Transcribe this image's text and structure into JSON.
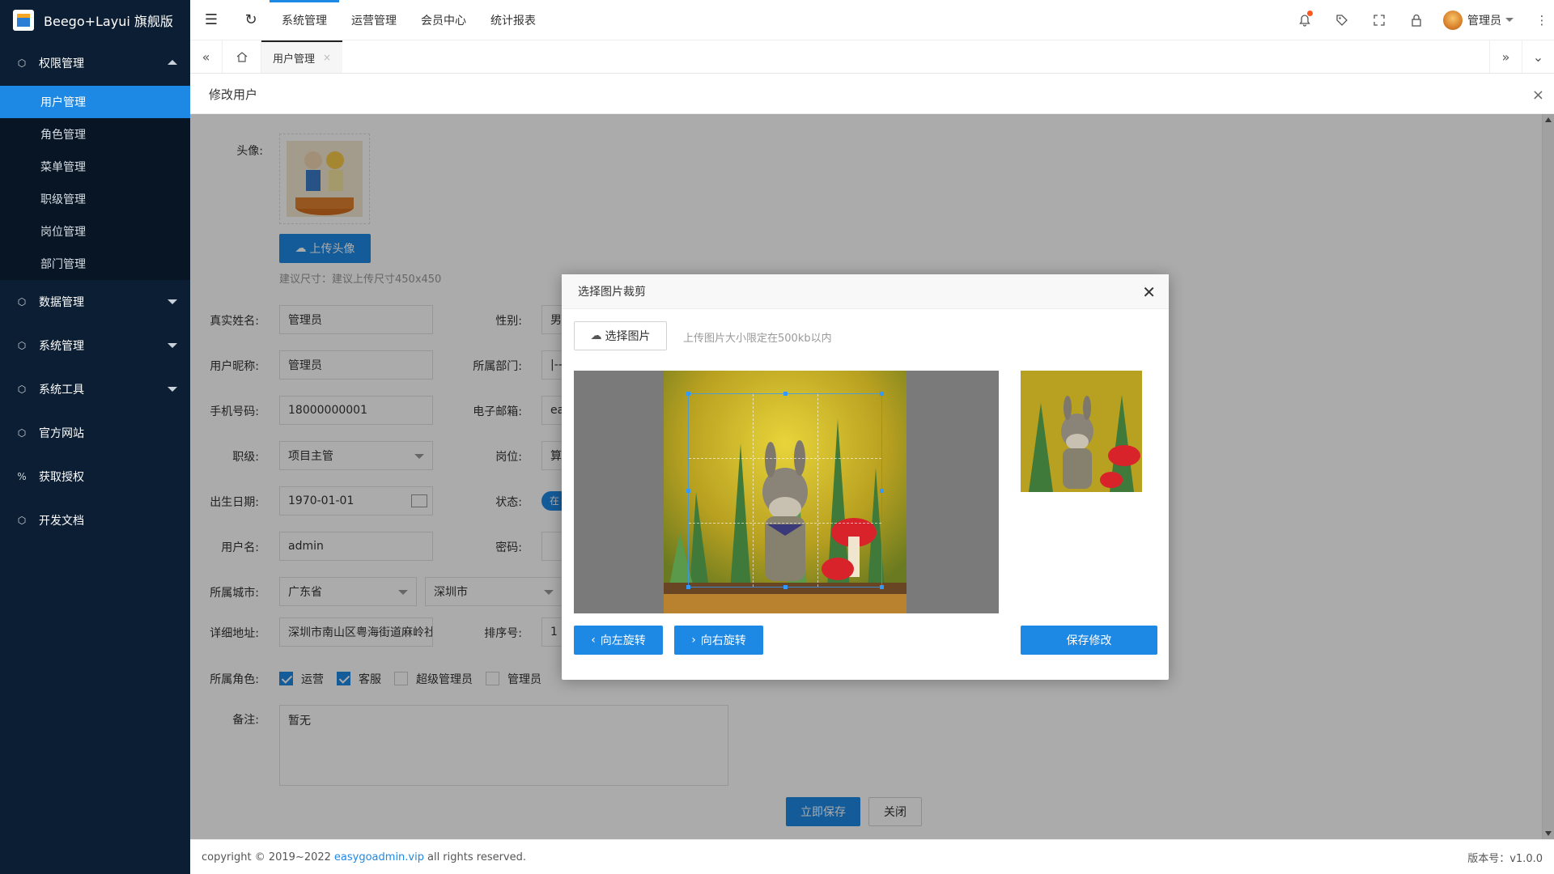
{
  "app": {
    "title": "Beego+Layui 旗舰版"
  },
  "sidebar": {
    "groups": [
      {
        "label": "权限管理",
        "expanded": true,
        "items": [
          {
            "label": "用户管理",
            "active": true
          },
          {
            "label": "角色管理"
          },
          {
            "label": "菜单管理"
          },
          {
            "label": "职级管理"
          },
          {
            "label": "岗位管理"
          },
          {
            "label": "部门管理"
          }
        ]
      },
      {
        "label": "数据管理"
      },
      {
        "label": "系统管理"
      },
      {
        "label": "系统工具"
      },
      {
        "label": "官方网站"
      },
      {
        "label": "获取授权"
      },
      {
        "label": "开发文档"
      }
    ]
  },
  "header": {
    "menus": [
      "系统管理",
      "运营管理",
      "会员中心",
      "统计报表"
    ],
    "user": "管理员"
  },
  "tabs": {
    "current": "用户管理"
  },
  "page": {
    "title": "修改用户"
  },
  "form": {
    "avatar_label": "头像:",
    "upload_btn": "上传头像",
    "upload_hint": "建议尺寸：建议上传尺寸450x450",
    "realname_label": "真实姓名:",
    "realname": "管理员",
    "gender_label": "性别:",
    "gender": "男",
    "nickname_label": "用户昵称:",
    "nickname": "管理员",
    "dept_label": "所属部门:",
    "dept": "|--",
    "mobile_label": "手机号码:",
    "mobile": "18000000001",
    "email_label": "电子邮箱:",
    "email": "ea",
    "level_label": "职级:",
    "level": "项目主管",
    "position_label": "岗位:",
    "position": "算",
    "birthday_label": "出生日期:",
    "birthday": "1970-01-01",
    "status_label": "状态:",
    "status": "在",
    "username_label": "用户名:",
    "username": "admin",
    "password_label": "密码:",
    "city_label": "所属城市:",
    "province": "广东省",
    "city": "深圳市",
    "address_label": "详细地址:",
    "address": "深圳市南山区粤海街道麻岭社",
    "sort_label": "排序号:",
    "sort": "1",
    "roles_label": "所属角色:",
    "roles": [
      {
        "label": "运营",
        "checked": true
      },
      {
        "label": "客服",
        "checked": true
      },
      {
        "label": "超级管理员",
        "checked": false
      },
      {
        "label": "管理员",
        "checked": false
      }
    ],
    "note_label": "备注:",
    "note": "暂无",
    "save_btn": "立即保存",
    "close_btn": "关闭"
  },
  "footer": {
    "copyright_pre": "copyright © 2019~2022",
    "link": "easygoadmin.vip",
    "copyright_post": "all rights reserved.",
    "version": "版本号：v1.0.0"
  },
  "modal": {
    "title": "选择图片裁剪",
    "choose_btn": "选择图片",
    "hint": "上传图片大小限定在500kb以内",
    "rotate_left": "向左旋转",
    "rotate_right": "向右旋转",
    "save_btn": "保存修改"
  },
  "colors": {
    "primary": "#1e88e5",
    "sidebar_bg": "#0c1e33",
    "notify_dot": "#ff5722"
  }
}
